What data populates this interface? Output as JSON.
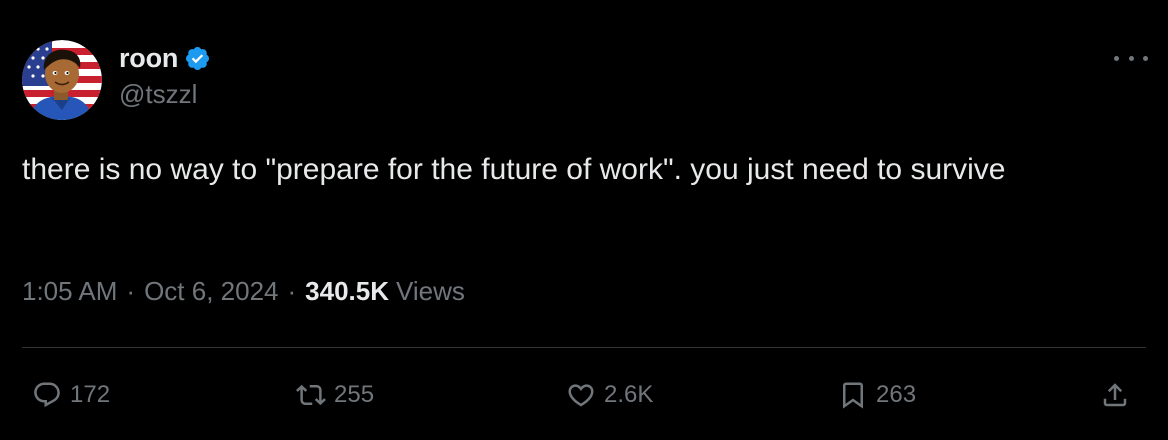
{
  "author": {
    "display_name": "roon",
    "handle": "@tszzl",
    "verified": true
  },
  "tweet": {
    "text": "there is no way to \"prepare for the future of work\". you just need to survive"
  },
  "meta": {
    "time": "1:05 AM",
    "separator": "·",
    "date": "Oct 6, 2024",
    "views_count": "340.5K",
    "views_label": "Views"
  },
  "actions": {
    "replies": "172",
    "reposts": "255",
    "likes": "2.6K",
    "bookmarks": "263"
  },
  "icons": {
    "reply": "reply-icon",
    "repost": "repost-icon",
    "like": "heart-icon",
    "bookmark": "bookmark-icon",
    "share": "share-icon",
    "more": "more-icon",
    "verified": "verified-badge-icon"
  },
  "colors": {
    "background": "#000000",
    "text_primary": "#e7e9ea",
    "text_secondary": "#71767b",
    "divider": "#2f3336",
    "verified": "#1d9bf0"
  }
}
